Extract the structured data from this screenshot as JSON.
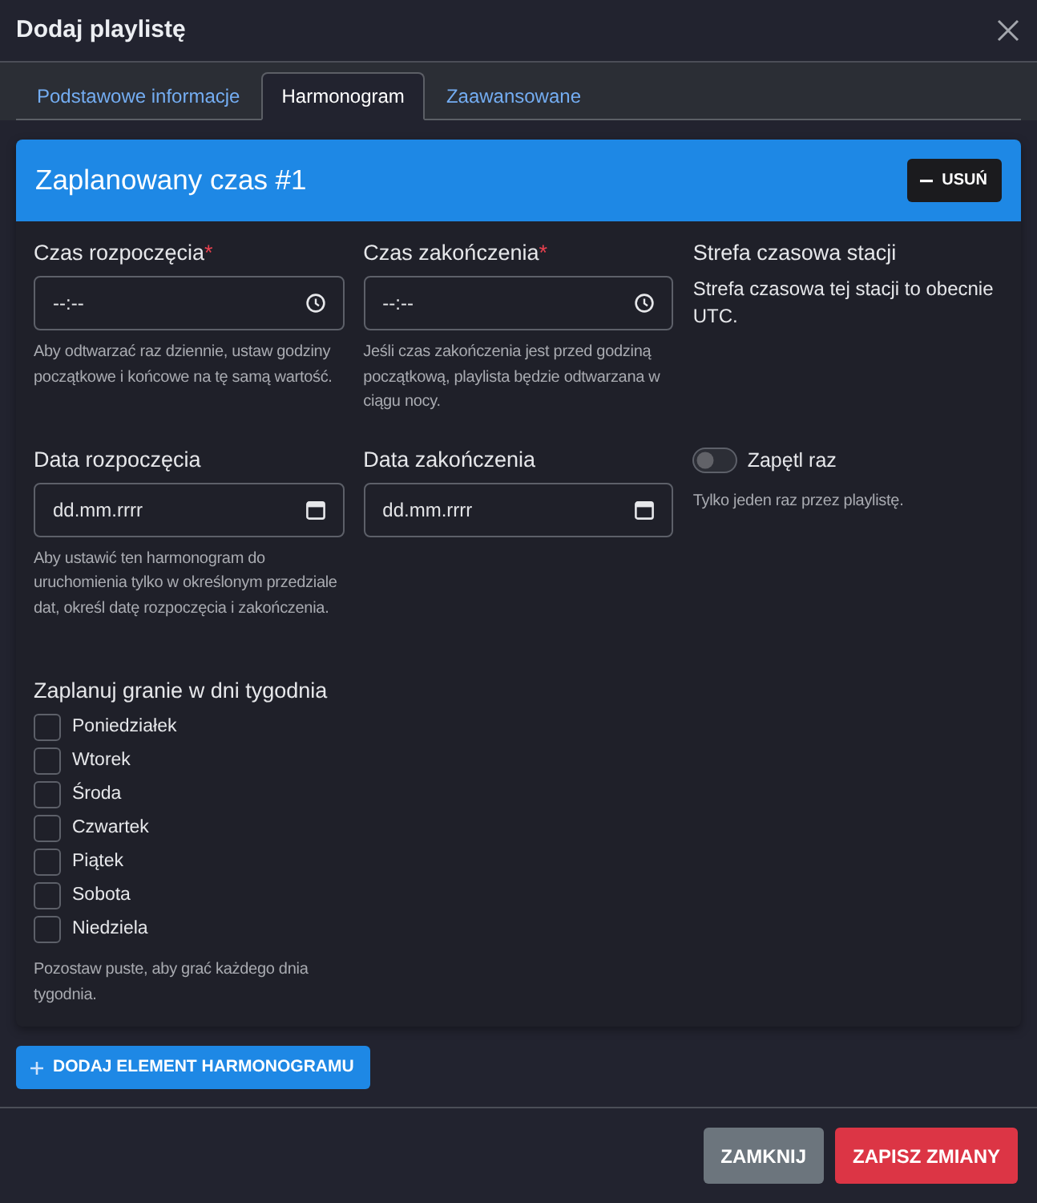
{
  "dialog": {
    "title": "Dodaj playlistę"
  },
  "tabs": [
    {
      "label": "Podstawowe informacje",
      "selected": false
    },
    {
      "label": "Harmonogram",
      "selected": true
    },
    {
      "label": "Zaawansowane",
      "selected": false
    }
  ],
  "schedule_items": [
    {
      "title": "Zaplanowany czas #1",
      "remove_button": "USUŃ",
      "fields": [
        {
          "kind": "time",
          "label": "Czas rozpoczęcia",
          "required_mark": "*",
          "placeholder": "--:--",
          "help": "Aby odtwarzać raz dziennie, ustaw godziny początkowe i końcowe na tę samą wartość."
        },
        {
          "kind": "time",
          "label": "Czas zakończenia",
          "required_mark": "*",
          "placeholder": "--:--",
          "help": "Jeśli czas zakończenia jest przed godziną początkową, playlista będzie odtwarzana w ciągu nocy."
        },
        {
          "kind": "info",
          "label": "Strefa czasowa stacji",
          "text": "Strefa czasowa tej stacji to obecnie UTC."
        },
        {
          "kind": "date",
          "label": "Data rozpoczęcia",
          "placeholder": "dd.mm.rrrr",
          "help": "Aby ustawić ten harmonogram do uruchomienia tylko w określonym przedziale dat, określ datę rozpoczęcia i zakończenia."
        },
        {
          "kind": "date",
          "label": "Data zakończenia",
          "placeholder": "dd.mm.rrrr"
        },
        {
          "kind": "toggle",
          "label": "Zapętl raz",
          "on": false,
          "help": "Tylko jeden raz przez playlistę."
        }
      ],
      "weekdays": {
        "label": "Zaplanuj granie w dni tygodnia",
        "days": [
          {
            "label": "Poniedziałek",
            "checked": false
          },
          {
            "label": "Wtorek",
            "checked": false
          },
          {
            "label": "Środa",
            "checked": false
          },
          {
            "label": "Czwartek",
            "checked": false
          },
          {
            "label": "Piątek",
            "checked": false
          },
          {
            "label": "Sobota",
            "checked": false
          },
          {
            "label": "Niedziela",
            "checked": false
          }
        ],
        "help": "Pozostaw puste, aby grać każdego dnia tygodnia."
      }
    }
  ],
  "add_button": "DODAJ ELEMENT HARMONOGRAMU",
  "footer_buttons": [
    {
      "label": "ZAMKNIJ",
      "kind": "secondary"
    },
    {
      "label": "ZAPISZ ZMIANY",
      "kind": "danger"
    }
  ]
}
